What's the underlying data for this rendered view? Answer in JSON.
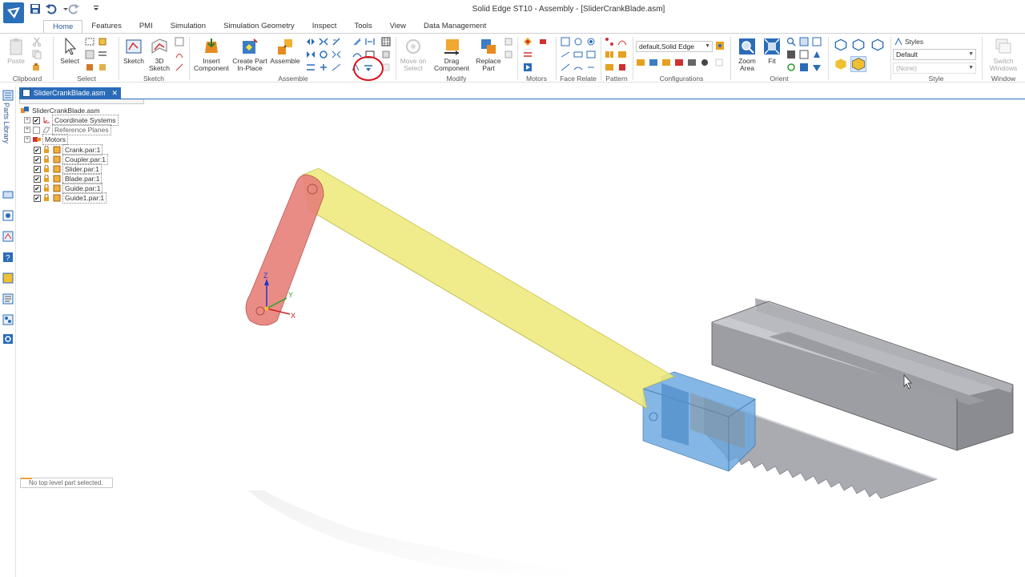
{
  "window": {
    "title": "Solid Edge ST10 - Assembly - [SliderCrankBlade.asm]"
  },
  "quick_access": [
    "save-icon",
    "undo-icon",
    "redo-icon",
    "customize-icon"
  ],
  "ribbon": {
    "tabs": [
      {
        "label": "Home",
        "active": true
      },
      {
        "label": "Features"
      },
      {
        "label": "PMI"
      },
      {
        "label": "Simulation"
      },
      {
        "label": "Simulation Geometry"
      },
      {
        "label": "Inspect"
      },
      {
        "label": "Tools"
      },
      {
        "label": "View"
      },
      {
        "label": "Data Management"
      }
    ],
    "groups": {
      "clipboard": {
        "label": "Clipboard",
        "paste": "Paste"
      },
      "select": {
        "label": "Select",
        "select": "Select"
      },
      "sketch": {
        "label": "Sketch",
        "sketch": "Sketch",
        "sketch3d_1": "3D",
        "sketch3d_2": "Sketch"
      },
      "assemble": {
        "label": "Assemble",
        "insert_1": "Insert",
        "insert_2": "Component",
        "create_1": "Create Part",
        "create_2": "In-Place",
        "assemble": "Assemble"
      },
      "modify": {
        "label": "Modify",
        "move_1": "Move on",
        "move_2": "Select",
        "drag_1": "Drag",
        "drag_2": "Component",
        "replace_1": "Replace",
        "replace_2": "Part"
      },
      "motors": {
        "label": "Motors"
      },
      "face_relate": {
        "label": "Face Relate"
      },
      "pattern": {
        "label": "Pattern"
      },
      "configurations": {
        "label": "Configurations",
        "combo_value": "default,Solid Edge"
      },
      "orient": {
        "label": "Orient",
        "zoom_1": "Zoom",
        "zoom_2": "Area",
        "fit": "Fit"
      },
      "style": {
        "label": "Style",
        "styles": "Styles",
        "style_value": "Default",
        "sub_value": "(None)"
      },
      "window": {
        "label": "Window",
        "switch_1": "Switch",
        "switch_2": "Windows"
      }
    }
  },
  "left_bar": {
    "parts_library": "Parts Library"
  },
  "document_tab": {
    "label": "SliderCrankBlade.asm"
  },
  "tree": {
    "root": "SliderCrankBlade.asm",
    "items": [
      {
        "label": "Coordinate Systems",
        "checked": true,
        "expander": "+"
      },
      {
        "label": "Reference Planes",
        "checked": false,
        "expander": "+"
      },
      {
        "label": "Motors",
        "expander": "+"
      },
      {
        "label": "Crank.par:1",
        "checked": true
      },
      {
        "label": "Coupler.par:1",
        "checked": true
      },
      {
        "label": "Slider.par:1",
        "checked": true
      },
      {
        "label": "Blade.par:1",
        "checked": true
      },
      {
        "label": "Guide.par:1",
        "checked": true
      },
      {
        "label": "Guide1.par:1",
        "checked": true
      }
    ]
  },
  "status": {
    "message": "No top level part selected."
  },
  "viewport": {
    "axes": {
      "x": "X",
      "y": "Y",
      "z": "Z"
    },
    "colors": {
      "crank": "#e8807a",
      "coupler": "#eeea7c",
      "slider": "#6aa8e0",
      "blade": "#a9abb0",
      "guide": "#a4a6ab"
    }
  }
}
